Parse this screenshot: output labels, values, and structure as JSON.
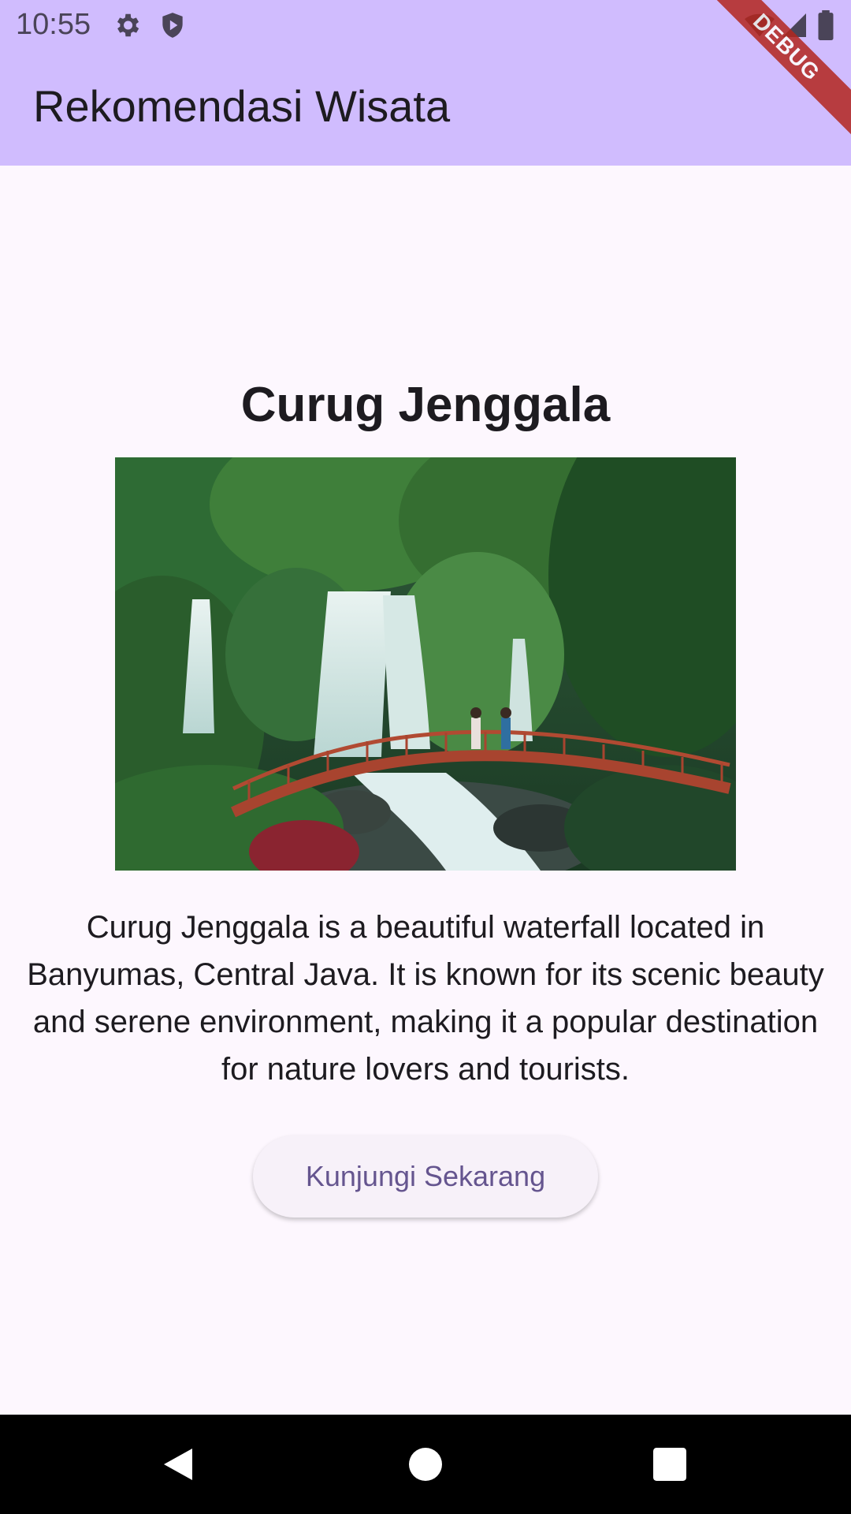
{
  "status_bar": {
    "time": "10:55",
    "icons": [
      "gear-icon",
      "shield-icon",
      "wifi-icon",
      "signal-icon",
      "battery-icon"
    ]
  },
  "app_bar": {
    "title": "Rekomendasi Wisata",
    "background": "#d0bcfe",
    "debug_banner": "DEBUG"
  },
  "place": {
    "title": "Curug Jenggala",
    "image_alt": "waterfall-with-bridge",
    "description": "Curug Jenggala is a beautiful waterfall located in Banyumas, Central Java. It is known for its scenic beauty and serene environment, making it a popular destination for nature lovers and tourists.",
    "button_label": "Kunjungi Sekarang",
    "accent_color": "#65558f"
  },
  "nav_bar": {
    "buttons": [
      "back-icon",
      "home-icon",
      "recents-icon"
    ]
  }
}
